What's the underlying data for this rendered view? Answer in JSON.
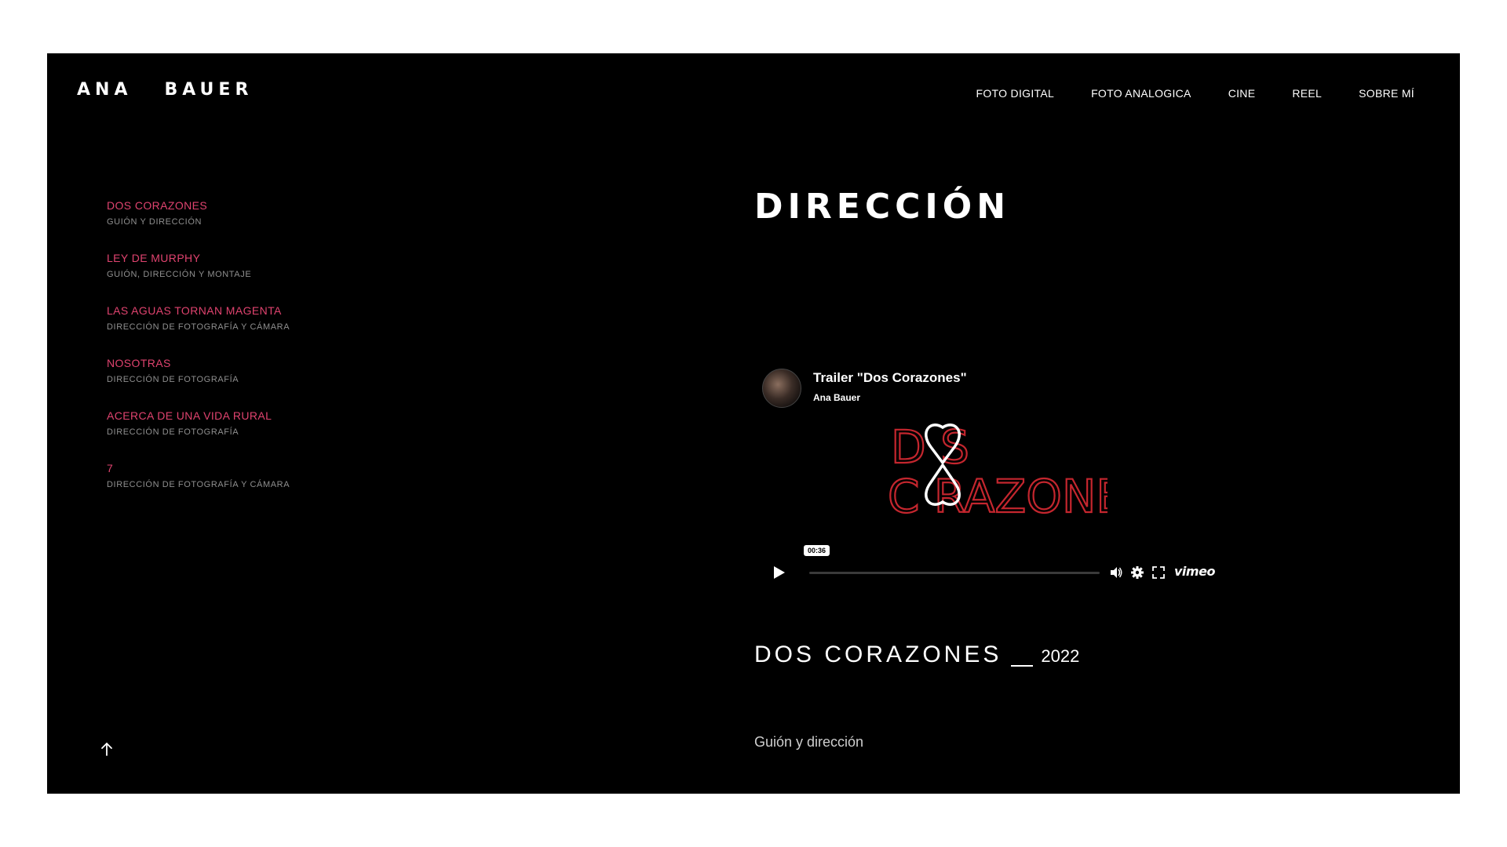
{
  "site": {
    "logo": "ANA   BAUER"
  },
  "nav": {
    "items": [
      "FOTO DIGITAL",
      "FOTO ANALOGICA",
      "CINE",
      "REEL",
      "SOBRE MÍ"
    ]
  },
  "sidebar": {
    "items": [
      {
        "title": "DOS CORAZONES",
        "subtitle": "GUIÓN Y DIRECCIÓN"
      },
      {
        "title": "LEY DE MURPHY",
        "subtitle": "GUIÓN, DIRECCIÓN Y MONTAJE"
      },
      {
        "title": "LAS AGUAS TORNAN MAGENTA",
        "subtitle": "DIRECCIÓN DE FOTOGRAFÍA Y CÁMARA"
      },
      {
        "title": "NOSOTRAS",
        "subtitle": "DIRECCIÓN DE FOTOGRAFÍA"
      },
      {
        "title": "ACERCA DE UNA VIDA RURAL",
        "subtitle": "DIRECCIÓN DE FOTOGRAFÍA"
      },
      {
        "title": "7",
        "subtitle": "DIRECCIÓN DE FOTOGRAFÍA Y CÁMARA"
      }
    ]
  },
  "main": {
    "page_title": "DIRECCIÓN",
    "video": {
      "title": "Trailer \"Dos Corazones\"",
      "author": "Ana Bauer",
      "time": "00:36",
      "progress": 0,
      "provider": "vimeo",
      "poster_line1": "D  S",
      "poster_line2": "C RAZONES"
    },
    "film": {
      "name": "DOS CORAZONES",
      "year": "2022",
      "description": "Guión y dirección"
    }
  },
  "colors": {
    "background": "#000000",
    "accent": "#e0436f",
    "text": "#ffffff",
    "muted": "#8f8f8f",
    "poster_red": "#c4262e"
  },
  "icons": {
    "play": "play-icon",
    "volume": "volume-icon",
    "settings": "gear-icon",
    "fullscreen": "fullscreen-icon",
    "back_to_top": "arrow-up-icon"
  }
}
